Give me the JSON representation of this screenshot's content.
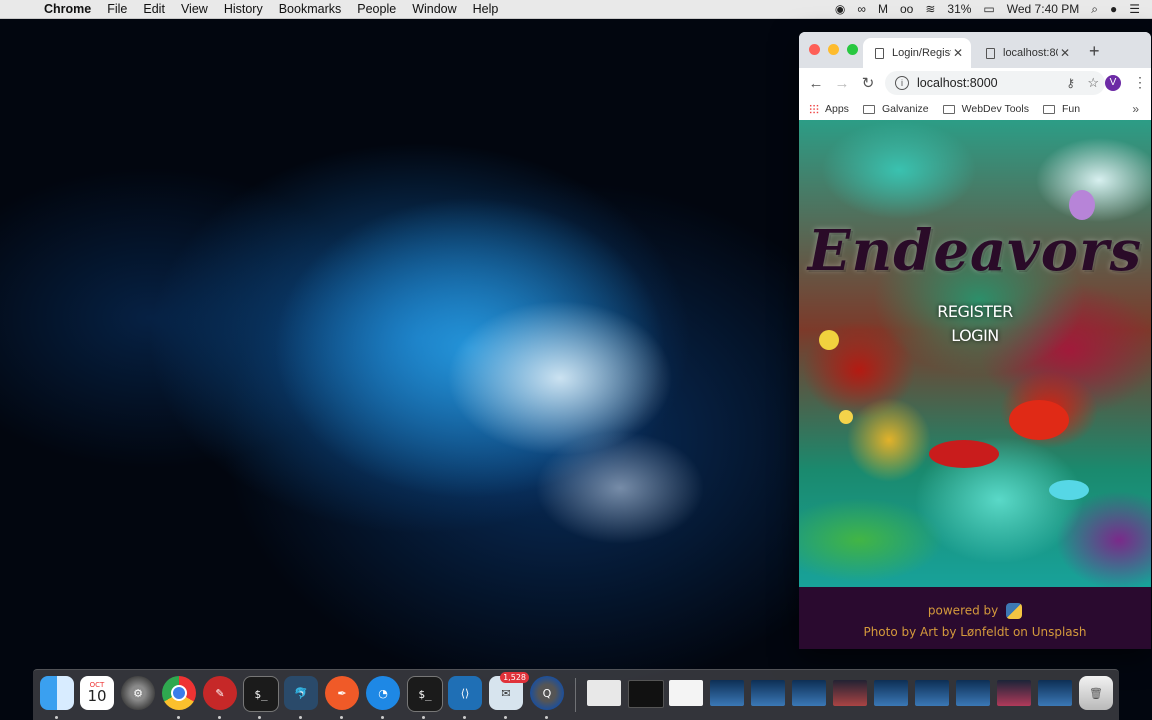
{
  "menubar": {
    "app": "Chrome",
    "items": [
      "File",
      "Edit",
      "View",
      "History",
      "Bookmarks",
      "People",
      "Window",
      "Help"
    ],
    "battery": "31%",
    "clock": "Wed 7:40 PM"
  },
  "browser": {
    "tabs": [
      {
        "title": "Login/Regist",
        "active": true
      },
      {
        "title": "localhost:80",
        "active": false
      }
    ],
    "url": "localhost:8000",
    "avatar_initial": "V",
    "bookmarks": [
      "Apps",
      "Galvanize",
      "WebDev Tools",
      "Fun"
    ],
    "bookmarks_more": "»"
  },
  "page": {
    "brand": "Endeavors",
    "register": "REGISTER",
    "login": "LOGIN",
    "powered_by": "powered by",
    "credit": "Photo by Art by Lønfeldt on Unsplash"
  },
  "dock": {
    "calendar_month": "OCT",
    "calendar_day": "10",
    "mail_badge": "1,528"
  },
  "colors": {
    "footer_bg": "#2a0a2f",
    "footer_text": "#d49a3c",
    "brand_text": "#2a0b28"
  }
}
